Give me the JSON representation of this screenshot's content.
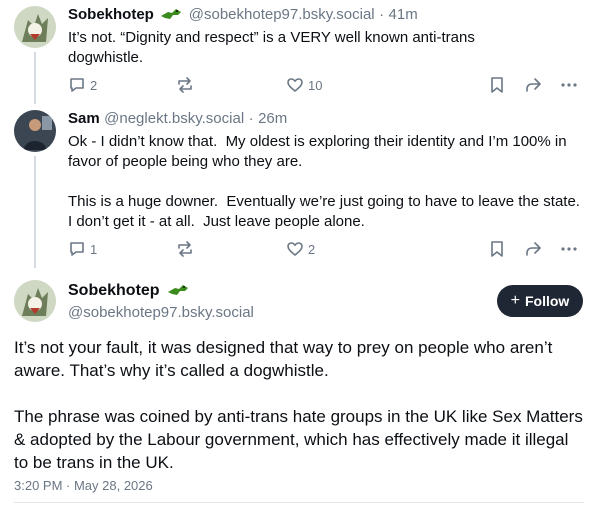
{
  "post1": {
    "author_name": "Sobekhotep",
    "handle": "@sobekhotep97.bsky.social",
    "time": "41m",
    "text": "It’s not. “Dignity and respect” is a VERY well known anti-trans dogwhistle.",
    "replies": "2",
    "reposts": "",
    "likes": "10"
  },
  "post2": {
    "author_name": "Sam",
    "handle": "@neglekt.bsky.social",
    "time": "26m",
    "text": "Ok - I didn’t know that.  My oldest is exploring their identity and I’m 100% in favor of people being who they are.\n\nThis is a huge downer.  Eventually we’re just going to have to leave the state.  I don’t get it - at all.  Just leave people alone.",
    "replies": "1",
    "reposts": "",
    "likes": "2"
  },
  "main": {
    "author_name": "Sobekhotep",
    "handle": "@sobekhotep97.bsky.social",
    "follow_label": "Follow",
    "text": "It’s not your fault, it was designed that way to prey on people who aren’t aware. That’s why it’s called a dogwhistle.\n\nThe phrase was coined by anti-trans hate groups in the UK like Sex Matters & adopted by the Labour government, which has effectively made it illegal to be trans in the UK.",
    "timestamp": "3:20 PM · May 28, 2026"
  },
  "colors": {
    "muted": "#6b7785",
    "follow_bg": "#1e2733",
    "crocodile": "#3a8a1c"
  }
}
